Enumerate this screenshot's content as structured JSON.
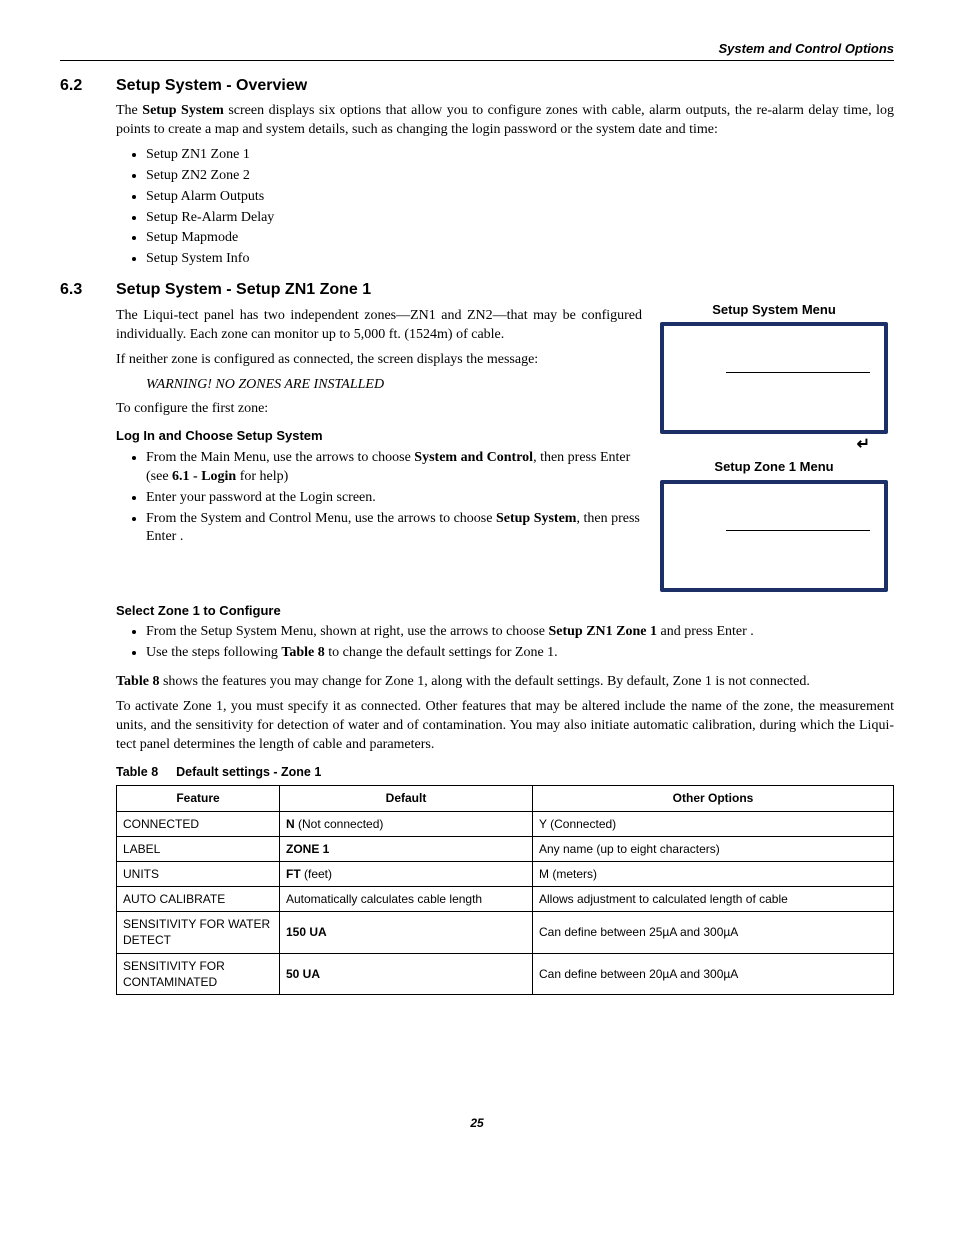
{
  "header": {
    "section_label": "System and Control Options"
  },
  "sec62": {
    "num": "6.2",
    "title": "Setup System - Overview",
    "intro_pre": "The ",
    "intro_bold": "Setup System",
    "intro_post": " screen displays six options that allow you to configure zones with cable, alarm outputs, the re-alarm delay time, log points to create a map and system details, such as changing the login password or the system date and time:",
    "items": [
      "Setup ZN1 Zone 1",
      "Setup ZN2 Zone 2",
      "Setup Alarm Outputs",
      "Setup Re-Alarm Delay",
      "Setup Mapmode",
      "Setup System Info"
    ]
  },
  "sec63": {
    "num": "6.3",
    "title": "Setup System - Setup ZN1 Zone 1",
    "p1": "The Liqui-tect panel has two independent zones—ZN1 and ZN2—that may be configured individually. Each zone can monitor up to 5,000 ft. (1524m) of cable.",
    "p2": "If neither zone is configured as connected, the screen displays the message:",
    "warn": "WARNING! NO ZONES ARE INSTALLED",
    "p3": "To configure the first zone:",
    "sub_login": "Log In and Choose Setup System",
    "login_items": {
      "i1_a": "From the Main Menu, use the arrows ",
      "i1_b": " to choose ",
      "i1_c": "System and Control",
      "i1_d": ", then press Enter ",
      "i1_e": " (see ",
      "i1_f": "6.1 - Login",
      "i1_g": " for help)",
      "i2": "Enter your password at the Login screen.",
      "i3_a": "From the System and Control Menu, use the arrows ",
      "i3_b": " to choose ",
      "i3_c": "Setup System",
      "i3_d": ", then press Enter ",
      "i3_e": "."
    },
    "sub_select": "Select Zone 1 to Configure",
    "select_items": {
      "i1_a": "From the Setup System Menu, shown at right, use the arrows ",
      "i1_b": " to choose ",
      "i1_c": "Setup ZN1 Zone 1",
      "i1_d": " and press Enter ",
      "i1_e": ".",
      "i2_a": "Use the steps following ",
      "i2_b": "Table 8",
      "i2_c": " to change the default settings for Zone 1."
    },
    "p4_a": "Table 8",
    "p4_b": " shows the features you may change for Zone 1, along with the default settings. By default, Zone 1 is not connected.",
    "p5": "To activate Zone 1, you must specify it as connected. Other features that may be altered include the name of the zone, the measurement units, and the sensitivity for detection of water and of contamination. You may also initiate automatic calibration, during which the Liqui-tect panel determines the length of cable and parameters.",
    "menus": {
      "title1": "Setup System Menu",
      "title2": "Setup Zone 1 Menu"
    }
  },
  "table8": {
    "num": "Table 8",
    "title": "Default settings - Zone 1",
    "head": {
      "c1": "Feature",
      "c2": "Default",
      "c3": "Other Options"
    },
    "rows": [
      {
        "feature": "CONNECTED",
        "def_b": "N",
        "def_r": " (Not connected)",
        "other": "Y (Connected)"
      },
      {
        "feature": "LABEL",
        "def_b": "ZONE 1",
        "def_r": "",
        "other": "Any name (up to eight characters)"
      },
      {
        "feature": "UNITS",
        "def_b": "FT",
        "def_r": " (feet)",
        "other": "M (meters)"
      },
      {
        "feature": "AUTO CALIBRATE",
        "def_b": "",
        "def_r": "Automatically calculates cable length",
        "other": "Allows adjustment to calculated length of cable"
      },
      {
        "feature": "SENSITIVITY FOR WATER DETECT",
        "def_b": "150 UA",
        "def_r": "",
        "other": "Can define between 25µA and 300µA"
      },
      {
        "feature": "SENSITIVITY FOR CONTAMINATED",
        "def_b": "50 UA",
        "def_r": "",
        "other": "Can define between 20µA and 300µA"
      }
    ]
  },
  "page": {
    "num": "25"
  }
}
